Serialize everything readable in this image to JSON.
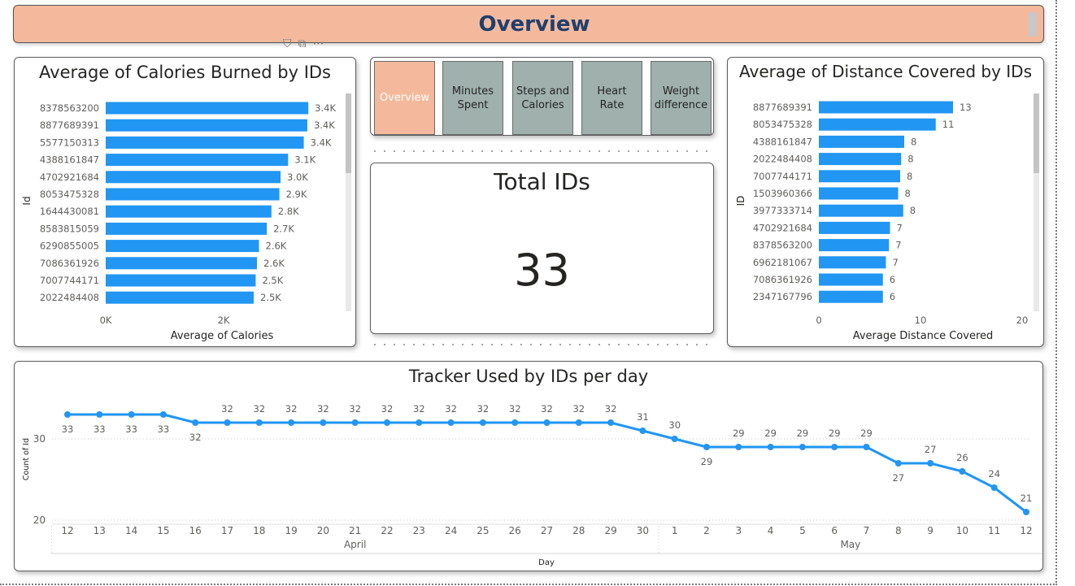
{
  "header": {
    "title": "Overview"
  },
  "nav": {
    "buttons": [
      {
        "label": "Overview",
        "active": true
      },
      {
        "label": "Minutes Spent",
        "active": false
      },
      {
        "label": "Steps and Calories",
        "active": false
      },
      {
        "label": "Heart Rate",
        "active": false
      },
      {
        "label": "Weight difference",
        "active": false
      }
    ]
  },
  "kpi": {
    "title": "Total IDs",
    "value": "33"
  },
  "colors": {
    "bar": "#2196f3",
    "header_bg": "#f4b99c",
    "header_text": "#1f3f6e",
    "nav_bg": "#9fb0ad"
  },
  "chart_data": [
    {
      "type": "bar",
      "orientation": "horizontal",
      "title": "Average of Calories Burned by IDs",
      "xlabel": "Average of Calories",
      "ylabel": "Id",
      "categories": [
        "8378563200",
        "8877689391",
        "5577150313",
        "4388161847",
        "4702921684",
        "8053475328",
        "1644430081",
        "8583815059",
        "6290855005",
        "7086361926",
        "7007744171",
        "2022484408"
      ],
      "values": [
        3437,
        3420,
        3360,
        3094,
        2966,
        2946,
        2811,
        2732,
        2600,
        2566,
        2544,
        2510
      ],
      "data_labels": [
        "3.4K",
        "3.4K",
        "3.4K",
        "3.1K",
        "3.0K",
        "2.9K",
        "2.8K",
        "2.7K",
        "2.6K",
        "2.6K",
        "2.5K",
        "2.5K"
      ],
      "xlim": [
        0,
        4000
      ],
      "xticks": [
        {
          "value": 0,
          "label": "0K"
        },
        {
          "value": 2000,
          "label": "2K"
        }
      ],
      "grid": false
    },
    {
      "type": "bar",
      "orientation": "horizontal",
      "title": "Average of Distance Covered by IDs",
      "xlabel": "Average Distance Covered",
      "ylabel": "ID",
      "categories": [
        "8877689391",
        "8053475328",
        "4388161847",
        "2022484408",
        "7007744171",
        "1503960366",
        "3977333714",
        "4702921684",
        "8378563200",
        "6962181067",
        "7086361926",
        "2347167796"
      ],
      "values": [
        13.2,
        11.5,
        8.4,
        8.1,
        8.0,
        7.8,
        8.3,
        7.0,
        6.9,
        6.6,
        6.3,
        6.3
      ],
      "data_labels": [
        "13",
        "11",
        "8",
        "8",
        "8",
        "8",
        "8",
        "7",
        "7",
        "7",
        "6",
        "6"
      ],
      "xlim": [
        0,
        20
      ],
      "xticks": [
        {
          "value": 0,
          "label": "0"
        },
        {
          "value": 10,
          "label": "10"
        },
        {
          "value": 20,
          "label": "20"
        }
      ],
      "grid": false
    },
    {
      "type": "line",
      "title": "Tracker Used by IDs per day",
      "xlabel": "Day",
      "ylabel": "Count of Id",
      "x": [
        "12",
        "13",
        "14",
        "15",
        "16",
        "17",
        "18",
        "19",
        "20",
        "21",
        "22",
        "23",
        "24",
        "25",
        "26",
        "27",
        "28",
        "29",
        "30",
        "1",
        "2",
        "3",
        "4",
        "5",
        "6",
        "7",
        "8",
        "9",
        "10",
        "11",
        "12"
      ],
      "groups": [
        {
          "label": "April",
          "from": 0,
          "to": 18
        },
        {
          "label": "May",
          "from": 19,
          "to": 30
        }
      ],
      "series": [
        {
          "values": [
            33,
            33,
            33,
            33,
            32,
            32,
            32,
            32,
            32,
            32,
            32,
            32,
            32,
            32,
            32,
            32,
            32,
            32,
            31,
            30,
            29,
            29,
            29,
            29,
            29,
            29,
            27,
            27,
            26,
            24,
            21
          ]
        }
      ],
      "ylim": [
        20,
        33
      ],
      "yticks": [
        20,
        30
      ],
      "grid": true
    }
  ]
}
